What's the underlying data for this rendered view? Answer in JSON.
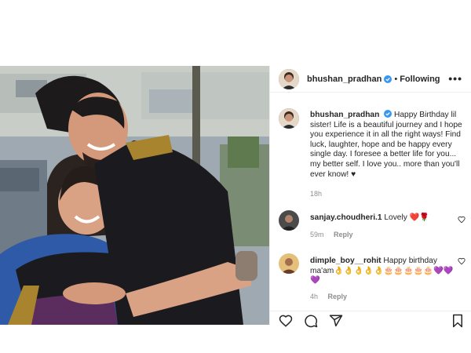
{
  "post": {
    "username": "bhushan_pradhan",
    "follow_label": "Following",
    "separator": "•",
    "more_label": "•••",
    "caption": "Happy Birthday lil sister! Life is a beautiful journey and I hope you experience it in all the right ways! Find luck, laughter, hope and be happy every single day. I foresee a better life for you... my better self. I love you.. more than you'll ever know! ♥",
    "time": "18h"
  },
  "comments": [
    {
      "username": "sanjay.choudheri.1",
      "text": "Lovely ❤️🌹",
      "time": "59m",
      "reply_label": "Reply"
    },
    {
      "username": "dimple_boy__rohit",
      "text": "Happy birthday ma'am👌👌👌👌👌🎂🎂🎂🎂🎂💜💜💜",
      "time": "4h",
      "reply_label": "Reply"
    }
  ],
  "colors": {
    "verified": "#3897f0",
    "text": "#262626",
    "muted": "#8e8e8e",
    "heart": "#ed4956",
    "kurta": "#1b1b1f",
    "sari": "#2f5aa8"
  },
  "icons": [
    "verified-badge-icon",
    "more-options-icon",
    "heart-icon",
    "comment-icon",
    "share-icon",
    "bookmark-icon"
  ]
}
